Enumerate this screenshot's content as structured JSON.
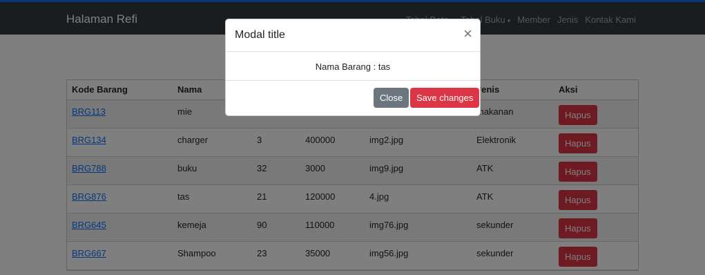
{
  "navbar": {
    "brand": "Halaman Refi",
    "links": [
      {
        "label": "Tabel Data",
        "dropdown": true
      },
      {
        "label": "Tabel Buku",
        "dropdown": true
      },
      {
        "label": "Member",
        "dropdown": false
      },
      {
        "label": "Jenis",
        "dropdown": false
      },
      {
        "label": "Kontak Kami",
        "dropdown": false
      }
    ],
    "caret": "▾"
  },
  "table": {
    "headers": [
      "Kode Barang",
      "Nama",
      "",
      "",
      "",
      "Jenis",
      "Aksi"
    ],
    "delete_label": "Hapus",
    "rows": [
      {
        "kode": "BRG113",
        "nama": "mie",
        "jumlah": "",
        "harga": "",
        "gambar": "",
        "jenis": "makanan"
      },
      {
        "kode": "BRG134",
        "nama": "charger",
        "jumlah": "3",
        "harga": "400000",
        "gambar": "img2.jpg",
        "jenis": "Elektronik"
      },
      {
        "kode": "BRG788",
        "nama": "buku",
        "jumlah": "32",
        "harga": "3000",
        "gambar": "img9.jpg",
        "jenis": "ATK"
      },
      {
        "kode": "BRG876",
        "nama": "tas",
        "jumlah": "21",
        "harga": "120000",
        "gambar": "4.jpg",
        "jenis": "ATK"
      },
      {
        "kode": "BRG645",
        "nama": "kemeja",
        "jumlah": "90",
        "harga": "110000",
        "gambar": "img76.jpg",
        "jenis": "sekunder"
      },
      {
        "kode": "BRG667",
        "nama": "Shampoo",
        "jumlah": "23",
        "harga": "35000",
        "gambar": "img56.jpg",
        "jenis": "sekunder"
      }
    ]
  },
  "modal": {
    "title": "Modal title",
    "close_icon": "×",
    "body": "Nama Barang : tas",
    "close_label": "Close",
    "save_label": "Save changes"
  },
  "colors": {
    "navbar_bg": "#343a40",
    "danger": "#dc3545",
    "secondary": "#6c757d",
    "link": "#0d6efd"
  }
}
